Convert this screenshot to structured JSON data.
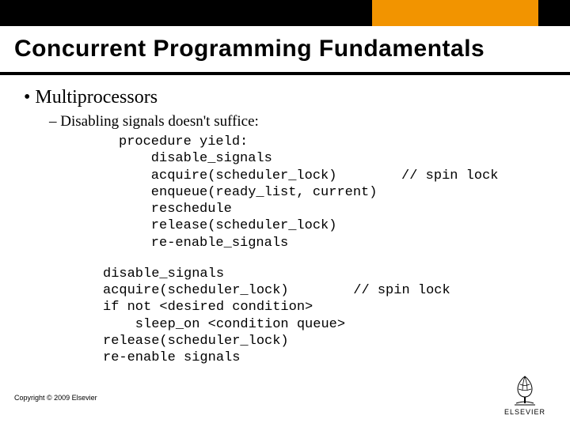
{
  "header": {
    "title": "Concurrent Programming Fundamentals"
  },
  "bullets": {
    "l1": "Multiprocessors",
    "l2": "Disabling signals doesn't suffice:"
  },
  "code1": "procedure yield:\n    disable_signals\n    acquire(scheduler_lock)        // spin lock\n    enqueue(ready_list, current)\n    reschedule\n    release(scheduler_lock)\n    re-enable_signals",
  "code2": "disable_signals\nacquire(scheduler_lock)        // spin lock\nif not <desired condition>\n    sleep_on <condition queue>\nrelease(scheduler_lock)\nre-enable signals",
  "footer": {
    "copyright": "Copyright © 2009 Elsevier",
    "logo_name": "ELSEVIER"
  }
}
